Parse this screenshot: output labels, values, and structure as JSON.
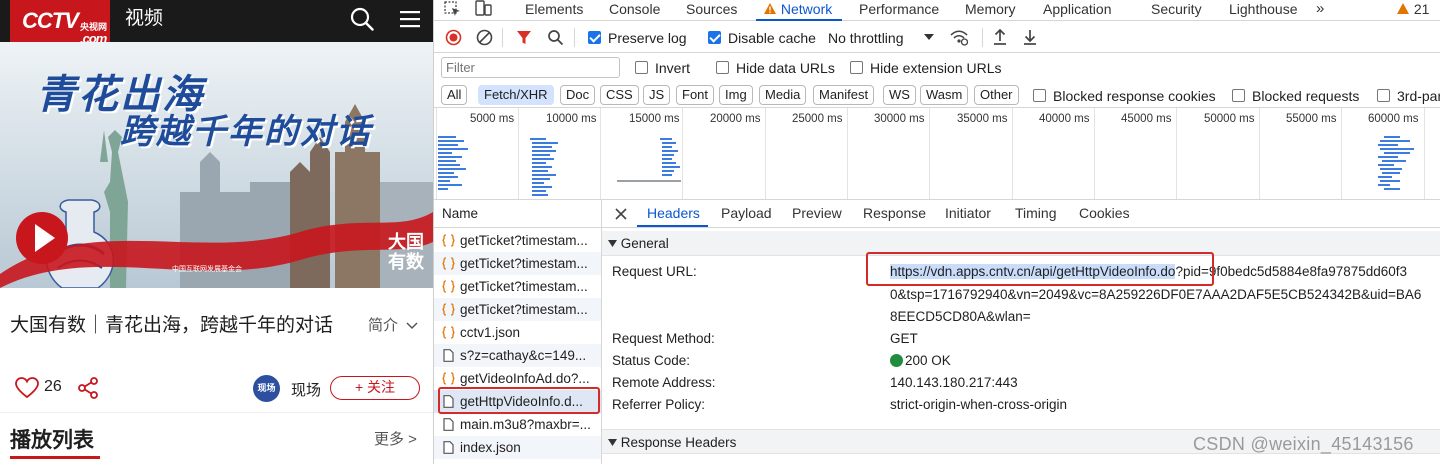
{
  "site": {
    "logo_text": "CCTV",
    "logo_cn": "央视网",
    "logo_com": ".com",
    "section": "视频",
    "banner": {
      "headline_line1": "青花出海",
      "headline_line2": "跨越千年的对话",
      "brand_badge_line1": "大国",
      "brand_badge_line2": "有数",
      "footer_note": "中国互联网发展基金会"
    },
    "video_title": "大国有数｜青花出海，跨越千年的对话",
    "intro_label": "简介",
    "like_count": "26",
    "channel_name": "现场",
    "channel_avatar_text": "现场",
    "follow_label": "+ 关注",
    "playlist_title": "播放列表",
    "more_label": "更多 >"
  },
  "devtools": {
    "tabs": [
      "Elements",
      "Console",
      "Sources",
      "Network",
      "Performance",
      "Memory",
      "Application",
      "Security",
      "Lighthouse"
    ],
    "active_tab": "Network",
    "warning_count": "21",
    "toolbar": {
      "preserve_log": "Preserve log",
      "disable_cache": "Disable cache",
      "throttling": "No throttling"
    },
    "filter": {
      "placeholder": "Filter",
      "invert": "Invert",
      "hide_data_urls": "Hide data URLs",
      "hide_extension_urls": "Hide extension URLs"
    },
    "type_chips": [
      "All",
      "Fetch/XHR",
      "Doc",
      "CSS",
      "JS",
      "Font",
      "Img",
      "Media",
      "Manifest",
      "WS",
      "Wasm",
      "Other"
    ],
    "active_chip": "Fetch/XHR",
    "type_checks": [
      "Blocked response cookies",
      "Blocked requests",
      "3rd-par"
    ],
    "timeline_ticks": [
      "5000 ms",
      "10000 ms",
      "15000 ms",
      "20000 ms",
      "25000 ms",
      "30000 ms",
      "35000 ms",
      "40000 ms",
      "45000 ms",
      "50000 ms",
      "55000 ms",
      "60000 ms"
    ],
    "name_header": "Name",
    "requests": [
      {
        "name": "getTicket?timestam...",
        "type": "xhr"
      },
      {
        "name": "getTicket?timestam...",
        "type": "xhr"
      },
      {
        "name": "getTicket?timestam...",
        "type": "xhr"
      },
      {
        "name": "getTicket?timestam...",
        "type": "xhr"
      },
      {
        "name": "cctv1.json",
        "type": "xhr"
      },
      {
        "name": "s?z=cathay&c=149...",
        "type": "doc"
      },
      {
        "name": "getVideoInfoAd.do?...",
        "type": "xhr"
      },
      {
        "name": "getHttpVideoInfo.d...",
        "type": "doc"
      },
      {
        "name": "main.m3u8?maxbr=...",
        "type": "doc"
      },
      {
        "name": "index.json",
        "type": "doc"
      }
    ],
    "selected_request": 7,
    "detail_tabs": [
      "Headers",
      "Payload",
      "Preview",
      "Response",
      "Initiator",
      "Timing",
      "Cookies"
    ],
    "active_detail_tab": "Headers",
    "general": {
      "title": "General",
      "request_url_label": "Request URL:",
      "request_url_highlight": "https://vdn.apps.cntv.cn/api/getHttpVideoInfo.do",
      "request_url_rest1": "?pid=9f0bedc5d5884e8fa97875dd60f3",
      "request_url_line2": "0&tsp=1716792940&vn=2049&vc=8A259226DF0E7AAA2DAF5E5CB524342B&uid=BA6",
      "request_url_line3": "8EECD5CD80A&wlan=",
      "method_label": "Request Method:",
      "method": "GET",
      "status_label": "Status Code:",
      "status": "200 OK",
      "remote_label": "Remote Address:",
      "remote": "140.143.180.217:443",
      "referrer_label": "Referrer Policy:",
      "referrer": "strict-origin-when-cross-origin"
    },
    "response_headers_title": "Response Headers"
  },
  "watermark": "CSDN @weixin_45143156",
  "colors": {
    "cctv_red": "#c8161d",
    "devtools_blue": "#1a73e8",
    "highlight_box": "#d62a2a",
    "status_green": "#1e8e3e"
  }
}
